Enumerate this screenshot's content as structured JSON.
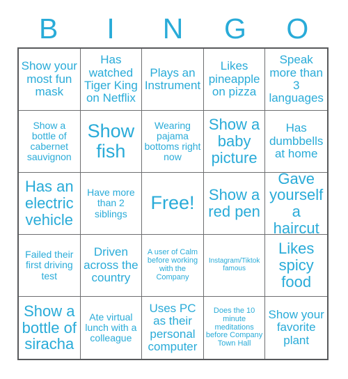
{
  "card": {
    "title": "BINGO",
    "accent_color": "#29abd8",
    "border_color": "#58595b",
    "grid_line_color": "#6d6e70",
    "background_color": "#ffffff"
  },
  "header": {
    "letters": [
      "B",
      "I",
      "N",
      "G",
      "O"
    ]
  },
  "grid": {
    "columns": 5,
    "rows": 5,
    "free_space_index": 12,
    "cells": [
      {
        "text": "Show your most fun mask",
        "size": "sz-md"
      },
      {
        "text": "Has watched Tiger King on Netflix",
        "size": "sz-md"
      },
      {
        "text": "Plays an Instrument",
        "size": "sz-md"
      },
      {
        "text": "Likes pineapple on pizza",
        "size": "sz-md"
      },
      {
        "text": "Speak more than 3 languages",
        "size": "sz-md"
      },
      {
        "text": "Show a bottle of cabernet sauvignon",
        "size": "sz-sm"
      },
      {
        "text": "Show fish",
        "size": "sz-xl"
      },
      {
        "text": "Wearing pajama bottoms right now",
        "size": "sz-sm"
      },
      {
        "text": "Show a baby picture",
        "size": "sz-lg"
      },
      {
        "text": "Has dumbbells at home",
        "size": "sz-md"
      },
      {
        "text": "Has an electric vehicle",
        "size": "sz-lg"
      },
      {
        "text": "Have more than 2 siblings",
        "size": "sz-sm"
      },
      {
        "text": "Free!",
        "size": "sz-xl"
      },
      {
        "text": "Show a red pen",
        "size": "sz-lg"
      },
      {
        "text": "Gave yourself a haircut",
        "size": "sz-lg"
      },
      {
        "text": "Failed their first driving test",
        "size": "sz-sm"
      },
      {
        "text": "Driven across the country",
        "size": "sz-md"
      },
      {
        "text": "A user of Calm before working with the Company",
        "size": "sz-xs"
      },
      {
        "text": "Instagram/Tiktok famous",
        "size": "sz-xxs"
      },
      {
        "text": "Likes spicy food",
        "size": "sz-lg"
      },
      {
        "text": "Show a bottle of siracha",
        "size": "sz-lg"
      },
      {
        "text": "Ate virtual lunch with a colleague",
        "size": "sz-sm"
      },
      {
        "text": "Uses PC as their personal computer",
        "size": "sz-md"
      },
      {
        "text": "Does the 10 minute meditations before Company Town Hall",
        "size": "sz-xs"
      },
      {
        "text": "Show your favorite plant",
        "size": "sz-md"
      }
    ]
  }
}
